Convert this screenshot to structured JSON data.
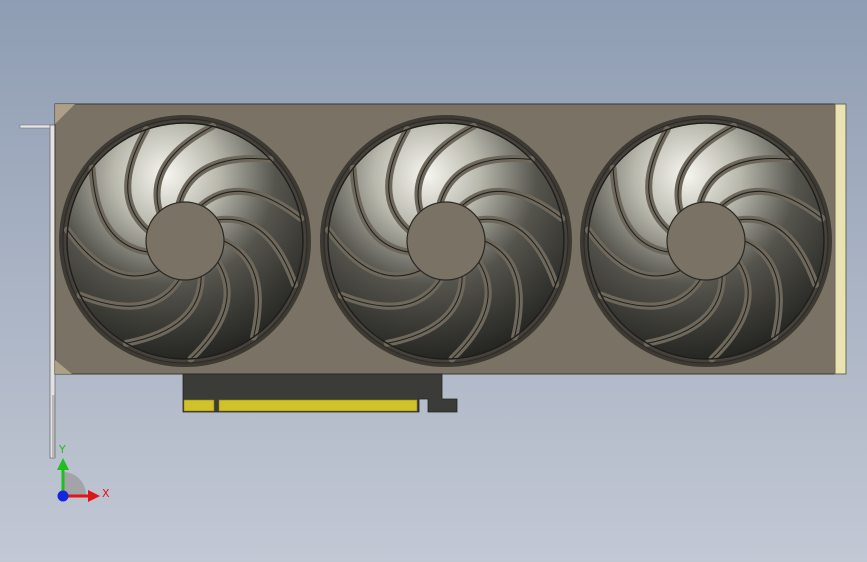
{
  "model": {
    "fan_count": 3,
    "blades_per_fan": 11
  },
  "colors": {
    "background_top": "#8e9db3",
    "background_bottom": "#c2c8d4",
    "shroud": "#7a7264",
    "shroud_edge": "#4a463f",
    "blade_dark": "#2a2a27",
    "blade_light": "#f4f4ee",
    "hub": "#7a7264",
    "pcb": "#3b3b37",
    "gold_contacts": "#d2c22a",
    "bracket": "#dcdcdc",
    "side_strip": "#e9e2b2",
    "axis_x": "#e01515",
    "axis_y": "#1fbf1f",
    "axis_z": "#1525e0"
  },
  "triad": {
    "x_label": "X",
    "y_label": "Y"
  }
}
